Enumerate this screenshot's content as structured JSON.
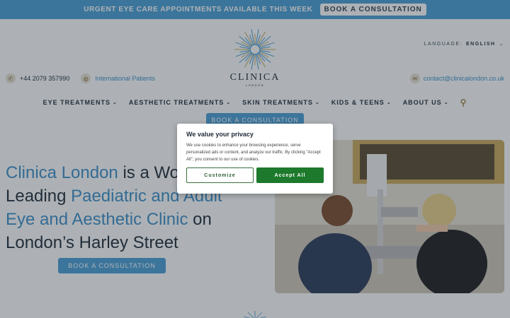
{
  "topbar": {
    "message": "URGENT EYE CARE APPOINTMENTS AVAILABLE THIS WEEK",
    "cta_label": "BOOK A CONSULTATION"
  },
  "logo": {
    "name": "CLINICA",
    "subtitle": "LONDON"
  },
  "language": {
    "label": "LANGUAGE:",
    "value": "ENGLISH"
  },
  "contact": {
    "phone": "+44 2079 357990",
    "international": "International Patients",
    "email": "contact@clinicalondon.co.uk"
  },
  "nav": {
    "items": [
      {
        "label": "EYE TREATMENTS"
      },
      {
        "label": "AESTHETIC TREATMENTS"
      },
      {
        "label": "SKIN TREATMENTS"
      },
      {
        "label": "KIDS & TEENS"
      },
      {
        "label": "ABOUT US"
      }
    ],
    "cta_label": "BOOK A CONSULTATION"
  },
  "hero": {
    "part1": "Clinica London",
    "part2": " is a World",
    "part3": "Leading ",
    "part4": "Paediatric and Adult",
    "part5": "Eye and Aesthetic Clinic",
    "part6": " on",
    "part7": "London’s Harley Street",
    "cta_label": "BOOK A CONSULTATION"
  },
  "cookie": {
    "title": "We value your privacy",
    "text": "We use cookies to enhance your browsing experience, serve personalized ads or content, and analyze our traffic. By clicking \"Accept All\", you consent to our use of cookies.",
    "customize_label": "Customize",
    "accept_label": "Accept All"
  },
  "icons": {
    "phone": "phone-icon",
    "globe": "globe-icon",
    "email": "mail-icon",
    "search": "search-icon",
    "chevron": "chevron-down-icon"
  },
  "colors": {
    "accent": "#4a9ed6",
    "gold": "#a48a4b",
    "dark": "#1e2a38",
    "accept": "#1d7a2c"
  }
}
